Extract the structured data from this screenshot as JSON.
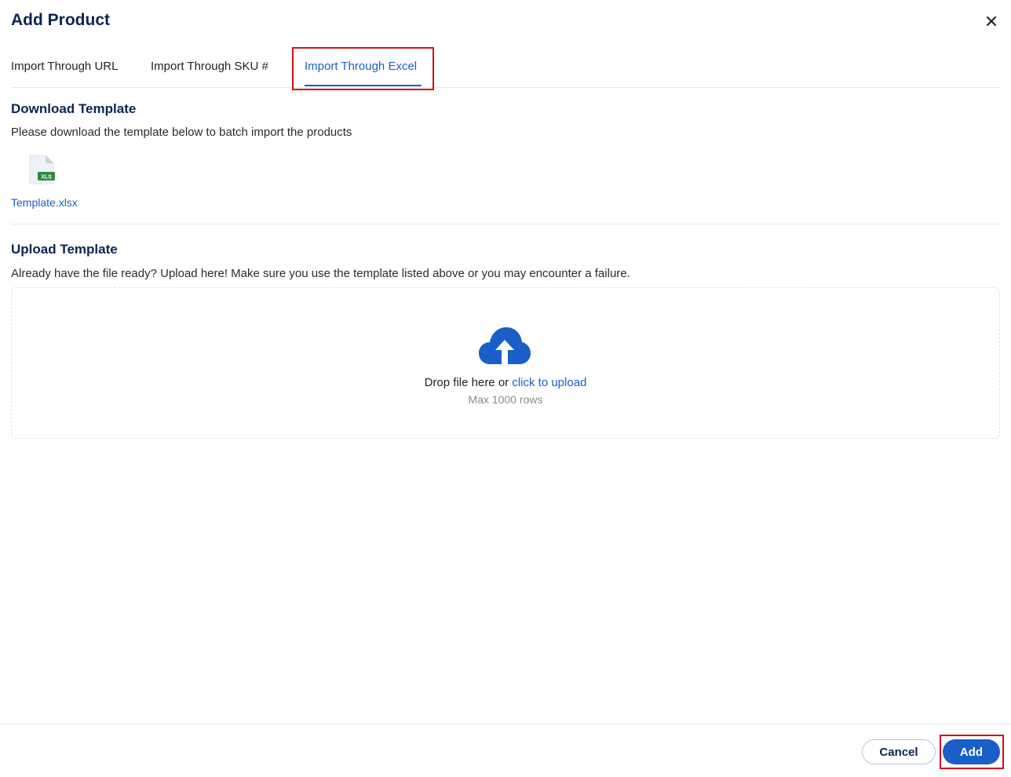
{
  "dialog": {
    "title": "Add Product",
    "close_icon": "close-icon"
  },
  "tabs": [
    {
      "label": "Import Through URL",
      "active": false
    },
    {
      "label": "Import Through SKU #",
      "active": false
    },
    {
      "label": "Import Through Excel",
      "active": true
    }
  ],
  "download": {
    "title": "Download Template",
    "description": "Please download the template below to batch import the products",
    "file_icon": "xls-file-icon",
    "file_badge": "XLS",
    "file_name": "Template.xlsx"
  },
  "upload": {
    "title": "Upload Template",
    "description": "Already have the file ready? Upload here! Make sure you use the template listed above or you may encounter a failure.",
    "icon": "cloud-upload-icon",
    "drop_text": "Drop file here or ",
    "drop_link": "click to upload",
    "limit": "Max 1000 rows"
  },
  "footer": {
    "cancel_label": "Cancel",
    "add_label": "Add"
  },
  "colors": {
    "primary": "#1a5fc8",
    "heading": "#0b2552",
    "highlight": "#d0121b",
    "xls_green": "#2e8b3d"
  }
}
